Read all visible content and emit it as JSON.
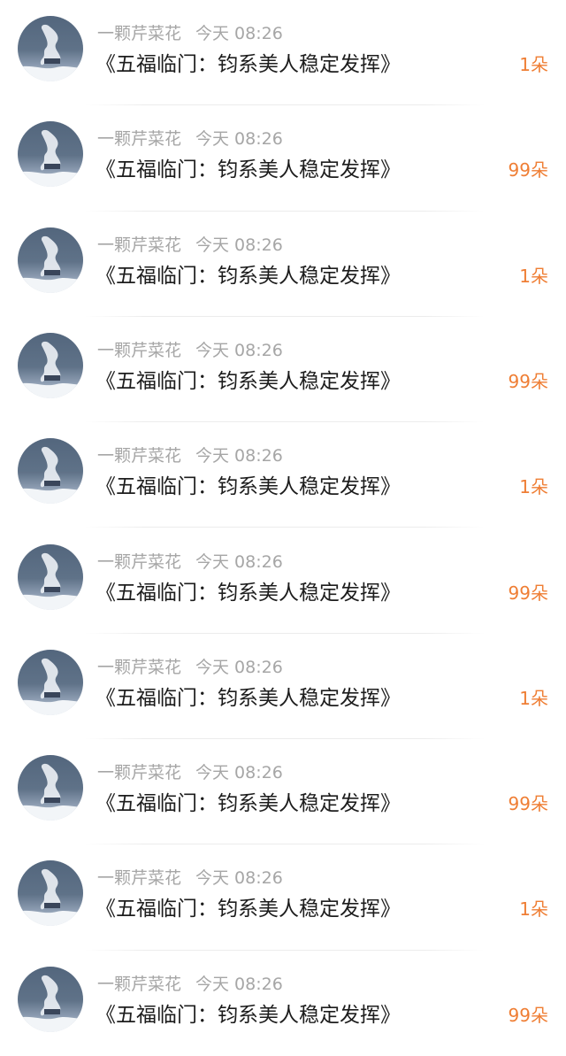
{
  "items": [
    {
      "username": "一颗芹菜花",
      "time": "今天 08:26",
      "title": "《五福临门：钧系美人稳定发挥》",
      "count": "1朵"
    },
    {
      "username": "一颗芹菜花",
      "time": "今天 08:26",
      "title": "《五福临门：钧系美人稳定发挥》",
      "count": "99朵"
    },
    {
      "username": "一颗芹菜花",
      "time": "今天 08:26",
      "title": "《五福临门：钧系美人稳定发挥》",
      "count": "1朵"
    },
    {
      "username": "一颗芹菜花",
      "time": "今天 08:26",
      "title": "《五福临门：钧系美人稳定发挥》",
      "count": "99朵"
    },
    {
      "username": "一颗芹菜花",
      "time": "今天 08:26",
      "title": "《五福临门：钧系美人稳定发挥》",
      "count": "1朵"
    },
    {
      "username": "一颗芹菜花",
      "time": "今天 08:26",
      "title": "《五福临门：钧系美人稳定发挥》",
      "count": "99朵"
    },
    {
      "username": "一颗芹菜花",
      "time": "今天 08:26",
      "title": "《五福临门：钧系美人稳定发挥》",
      "count": "1朵"
    },
    {
      "username": "一颗芹菜花",
      "time": "今天 08:26",
      "title": "《五福临门：钧系美人稳定发挥》",
      "count": "99朵"
    },
    {
      "username": "一颗芹菜花",
      "time": "今天 08:26",
      "title": "《五福临门：钧系美人稳定发挥》",
      "count": "1朵"
    },
    {
      "username": "一颗芹菜花",
      "time": "今天 08:26",
      "title": "《五福临门：钧系美人稳定发挥》",
      "count": "99朵"
    }
  ],
  "colors": {
    "count_accent": "#ef7e34",
    "meta_text": "#a6a6a6",
    "title_text": "#1d1d1d"
  },
  "icons": {
    "avatar": "user-avatar-photo"
  }
}
